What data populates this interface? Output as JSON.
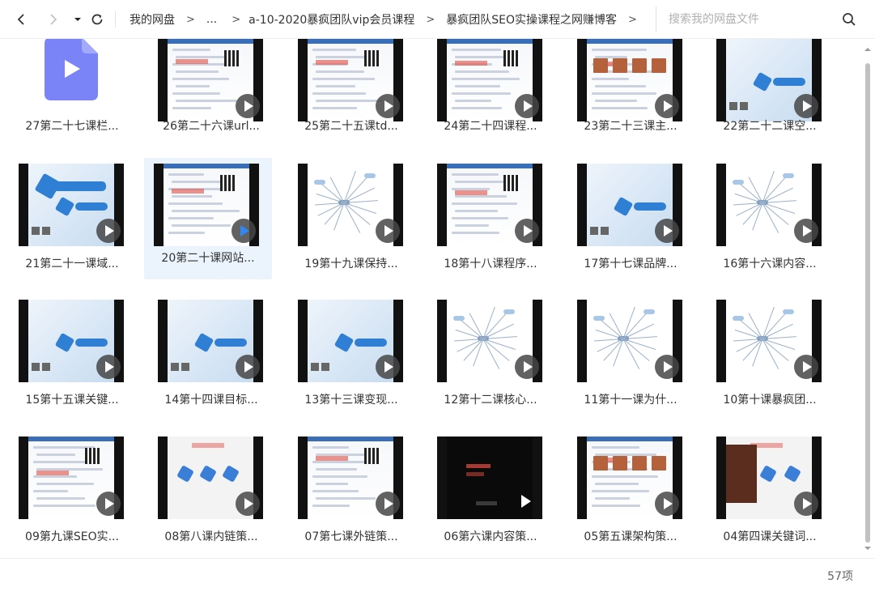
{
  "nav": {
    "breadcrumb": [
      "我的网盘",
      "...",
      "a-10-2020暴疯团队vip会员课程",
      "暴疯团队SEO实操课程之网赚博客"
    ],
    "separator": ">",
    "search_placeholder": "搜索我的网盘文件"
  },
  "files": [
    {
      "name": "27第二十七课栏...",
      "kind": "file-icon"
    },
    {
      "name": "26第二十六课url...",
      "kind": "page"
    },
    {
      "name": "25第二十五课td...",
      "kind": "form"
    },
    {
      "name": "24第二十四课程...",
      "kind": "page"
    },
    {
      "name": "23第二十三课主...",
      "kind": "shop"
    },
    {
      "name": "22第二十二课空...",
      "kind": "slide"
    },
    {
      "name": "21第二十一课域...",
      "kind": "slide-title"
    },
    {
      "name": "20第二十课网站...",
      "kind": "page",
      "selected": true
    },
    {
      "name": "19第十九课保持...",
      "kind": "mind"
    },
    {
      "name": "18第十八课程序...",
      "kind": "page"
    },
    {
      "name": "17第十七课品牌...",
      "kind": "slide"
    },
    {
      "name": "16第十六课内容...",
      "kind": "mind"
    },
    {
      "name": "15第十五课关键...",
      "kind": "slide"
    },
    {
      "name": "14第十四课目标...",
      "kind": "slide"
    },
    {
      "name": "13第十三课变现...",
      "kind": "slide"
    },
    {
      "name": "12第十二课核心...",
      "kind": "mind"
    },
    {
      "name": "11第十一课为什...",
      "kind": "mind"
    },
    {
      "name": "10第十课暴疯团...",
      "kind": "mind"
    },
    {
      "name": "09第九课SEO实...",
      "kind": "page"
    },
    {
      "name": "08第八课内链策...",
      "kind": "hex"
    },
    {
      "name": "07第七课外链策...",
      "kind": "form"
    },
    {
      "name": "06第六课内容策...",
      "kind": "dark"
    },
    {
      "name": "05第五课架构策...",
      "kind": "shop"
    },
    {
      "name": "04第四课关键词...",
      "kind": "hex-photo"
    }
  ],
  "status": {
    "item_count": "57项"
  },
  "colors": {
    "accent": "#2f88f5",
    "selected_bg": "#ebf4fd",
    "file_icon": "#7b84f6"
  }
}
